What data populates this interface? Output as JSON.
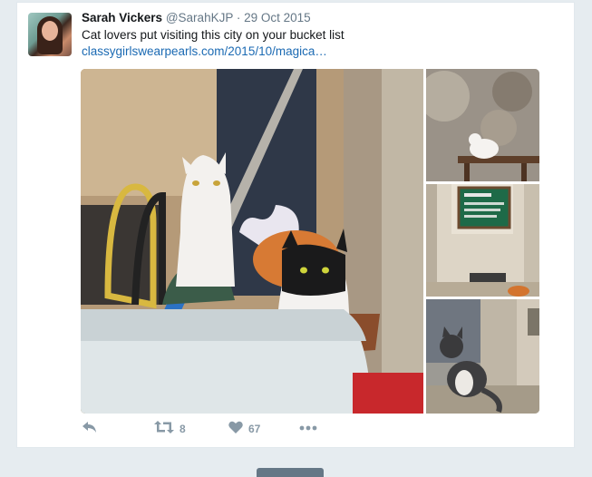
{
  "tweet": {
    "display_name": "Sarah Vickers",
    "handle": "@SarahKJP",
    "separator": "·",
    "date": "29 Oct 2015",
    "text": "Cat lovers put visiting this city on your bucket list",
    "link": "classygirlswearpearls.com/2015/10/magica…"
  },
  "media": {
    "main_photo": "cats-in-courtyard-photo",
    "thumbnails": [
      "white-cat-on-bench-photo",
      "green-sign-doorway-photo",
      "tabby-cat-sitting-photo"
    ]
  },
  "actions": {
    "reply_icon": "reply-icon",
    "retweet_icon": "retweet-icon",
    "retweet_count": "8",
    "like_icon": "heart-icon",
    "like_count": "67",
    "more_icon": "more-icon"
  },
  "colors": {
    "link": "#1b6ab3",
    "muted": "#8899a6",
    "background": "#e6ecf0"
  }
}
